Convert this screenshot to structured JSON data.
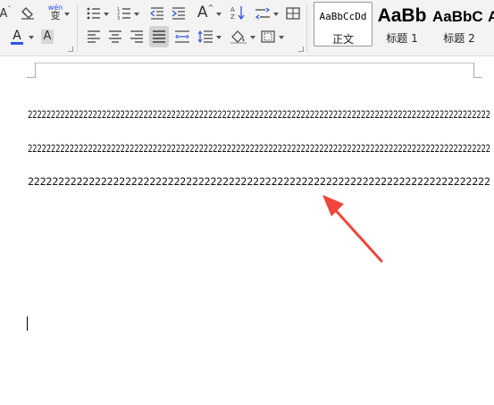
{
  "toolbar": {
    "font_decrease_glyph": "A",
    "clear_format_glyph": "A",
    "pinyin_top": "wén",
    "pinyin_bottom": "变",
    "font_color_glyph": "A",
    "font_color_accent": "#2f52e0",
    "char_shading_glyph": "A",
    "font_size_up_glyph": "A",
    "icons": [
      "font-decrease-icon",
      "clear-format-icon",
      "pinyin-guide-icon",
      "font-color-icon",
      "highlight-icon",
      "char-shading-icon",
      "bullet-list-icon",
      "numbered-list-icon",
      "decrease-indent-icon",
      "increase-indent-icon",
      "sort-icon",
      "font-size-increase-icon",
      "line-spacing-icon",
      "table-icon",
      "align-left-icon",
      "align-center-icon",
      "align-right-icon",
      "justify-icon",
      "distributed-icon",
      "paragraph-spacing-icon",
      "shading-icon",
      "border-icon"
    ]
  },
  "styles": {
    "normal": {
      "sample": "AaBbCcDd",
      "label": "正文"
    },
    "heading1": {
      "sample": "AaBb",
      "label": "标题 1"
    },
    "heading2": {
      "sample": "AaBbC",
      "label": "标题 2"
    },
    "heading3": {
      "sample": "A"
    }
  },
  "document": {
    "lines": [
      "2222222222222222222222222222222222222222222222222222222222222222222222222222222222222222222222222222",
      "2222222222222222222222222222222222222222222222222222222222222222222222222222222222222222222222222222",
      "2222222222222222222222222222222222222222222222222222222222222222222222222222"
    ]
  },
  "annotation": {
    "arrow_color": "#f0453a"
  }
}
